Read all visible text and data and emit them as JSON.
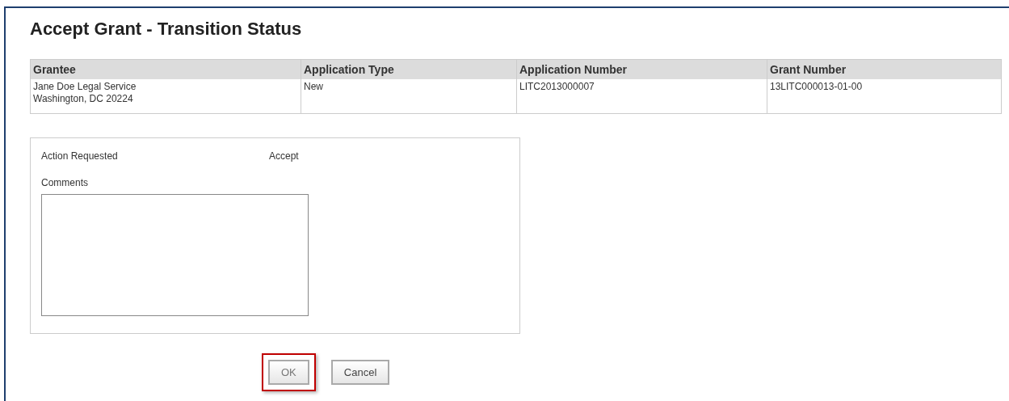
{
  "page": {
    "title": "Accept Grant - Transition Status"
  },
  "table": {
    "columns": [
      "Grantee",
      "Application Type",
      "Application Number",
      "Grant Number"
    ],
    "rows": [
      {
        "cells": [
          [
            "Jane Doe Legal Service",
            "Washington, DC 20224"
          ],
          [
            "New"
          ],
          [
            "LITC2013000007"
          ],
          [
            "13LITC000013-01-00"
          ]
        ]
      }
    ]
  },
  "form": {
    "action_label": "Action Requested",
    "action_value": "Accept",
    "comments_label": "Comments"
  },
  "buttons": [
    {
      "label": "OK",
      "highlighted": true
    },
    {
      "label": "Cancel",
      "highlighted": false
    }
  ]
}
